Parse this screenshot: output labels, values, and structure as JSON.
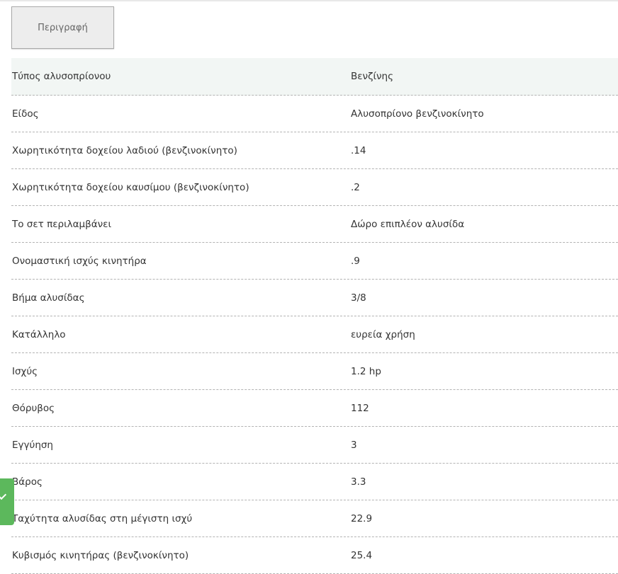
{
  "header": {
    "tab_label": "Περιγραφή"
  },
  "specs": [
    {
      "label": "Τύπος αλυσοπρίονου",
      "value": "Βενζίνης"
    },
    {
      "label": "Είδος",
      "value": "Αλυσοπρίονο βενζινοκίνητο"
    },
    {
      "label": "Χωρητικότητα δοχείου λαδιού (βενζινοκίνητο)",
      "value": ".14"
    },
    {
      "label": "Χωρητικότητα δοχείου καυσίμου (βενζινοκίνητο)",
      "value": ".2"
    },
    {
      "label": "Το σετ περιλαμβάνει",
      "value": "Δώρο επιπλέον αλυσίδα"
    },
    {
      "label": "Ονομαστική ισχύς κινητήρα",
      "value": ".9"
    },
    {
      "label": "Βήμα αλυσίδας",
      "value": "3/8"
    },
    {
      "label": "Κατάλληλο",
      "value": "ευρεία χρήση"
    },
    {
      "label": "Ισχύς",
      "value": "1.2 hp"
    },
    {
      "label": "Θόρυβος",
      "value": "112"
    },
    {
      "label": "Εγγύηση",
      "value": "3"
    },
    {
      "label": "Βάρος",
      "value": "3.3"
    },
    {
      "label": "Ταχύτητα αλυσίδας στη μέγιστη ισχύ",
      "value": "22.9"
    },
    {
      "label": "Κυβισμός κινητήρας (βενζινοκίνητο)",
      "value": "25.4"
    }
  ],
  "colors": {
    "accent_green": "#5cb85c",
    "header_row_bg": "#f2f6f4"
  },
  "icons": {
    "side_widget": "chevron-down-icon"
  }
}
